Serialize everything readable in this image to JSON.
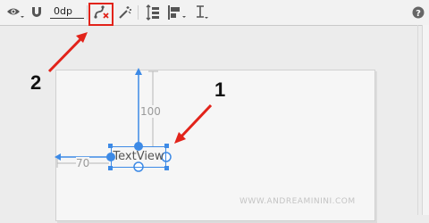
{
  "toolbar": {
    "items": [
      {
        "name": "eye-icon"
      },
      {
        "name": "magnet-icon"
      },
      {
        "name": "dp-field",
        "value": "0dp"
      },
      {
        "name": "clear-constraints-icon"
      },
      {
        "name": "magic-wand-icon"
      },
      {
        "name": "pack-icon"
      },
      {
        "name": "align-icon"
      },
      {
        "name": "guidelines-icon"
      },
      {
        "name": "help-icon"
      }
    ],
    "default_margin": "0dp"
  },
  "annotations": {
    "label_1": "1",
    "label_2": "2",
    "arrow_color": "#e2231a"
  },
  "canvas": {
    "widget_text": "TextView",
    "margin_top": "100",
    "margin_left": "70",
    "selection_color": "#3d8ae6"
  },
  "watermark": "WWW.ANDREAMININI.COM"
}
